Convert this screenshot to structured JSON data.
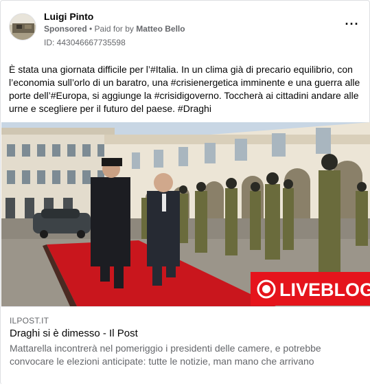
{
  "post": {
    "author": "Luigi Pinto",
    "sponsored_label": "Sponsored",
    "separator": " • ",
    "paid_for_prefix": "Paid for by ",
    "payer": "Matteo Bello",
    "ad_id": "ID: 443046667735598",
    "more_label": "···",
    "text": "È stata una giornata difficile per l’#Italia. In un clima già di precario equilibrio, con l’economia sull’orlo di un baratro, una #crisienergetica imminente e una guerra alle porte dell’#Europa, si aggiunge la #crisidigoverno. Toccherà ai cittadini andare alle urne e scegliere per il futuro del paese. #Draghi"
  },
  "media": {
    "badge_text": "LIVEBLOG",
    "badge_color": "#e5141c"
  },
  "link": {
    "domain": "ILPOST.IT",
    "title": "Draghi si è dimesso - Il Post",
    "description": "Mattarella incontrerà nel pomeriggio i presidenti delle camere, e potrebbe convocare le elezioni anticipate: tutte le notizie, man mano che arrivano"
  },
  "icons": {
    "more": "more-options-icon",
    "live": "record-icon"
  }
}
